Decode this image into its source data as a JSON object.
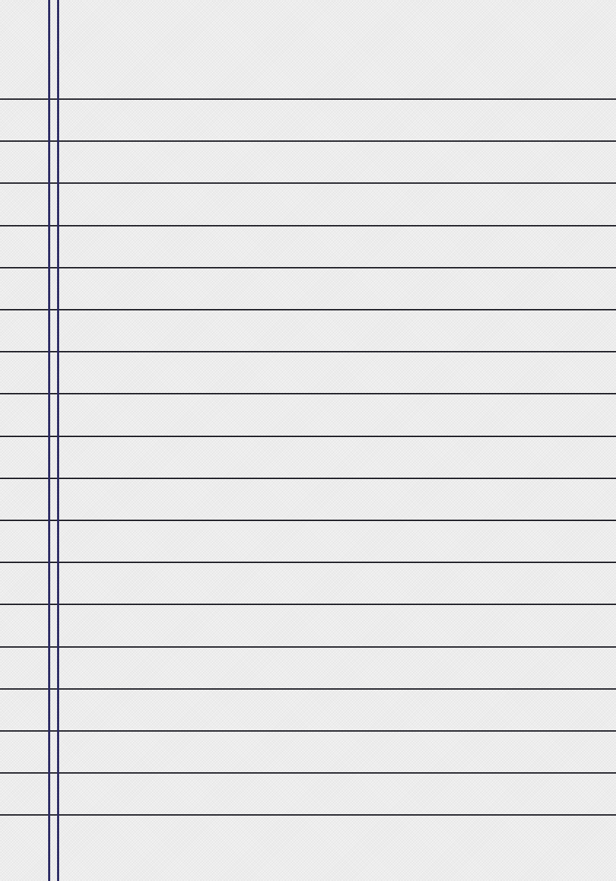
{
  "paper": {
    "style": "ruled notebook page",
    "ruled_line_count": 18,
    "margin_line_count": 2,
    "colors": {
      "background": "#ececec",
      "rule_line": "#1c1c24",
      "margin_line": "#2b2a63"
    }
  }
}
